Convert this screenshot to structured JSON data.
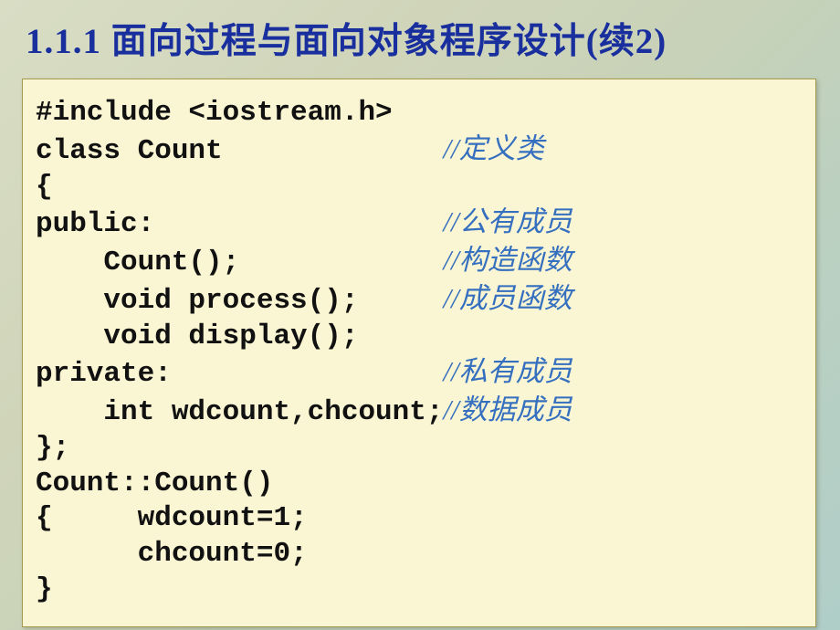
{
  "slide": {
    "title": "1.1.1  面向过程与面向对象程序设计(续2)",
    "code": {
      "l1": "#include <iostream.h>",
      "l2a": "class Count",
      "l2b": "//定义类",
      "l3": "{",
      "l4a": "public:",
      "l4b": "//公有成员",
      "l5a": "    Count();",
      "l5b": "//构造函数",
      "l6a": "    void process();",
      "l6b": "//成员函数",
      "l7": "    void display();",
      "l8a": "private:",
      "l8b": "//私有成员",
      "l9a": "    int wdcount,chcount;",
      "l9b": "//数据成员",
      "l10": "};",
      "l11": "Count::Count()",
      "l12": "{     wdcount=1;",
      "l13": "      chcount=0;",
      "l14": "}"
    }
  }
}
